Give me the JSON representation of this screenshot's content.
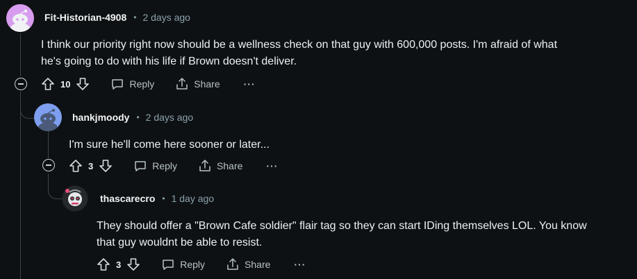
{
  "comments": [
    {
      "author": "Fit-Historian-4908",
      "time": "2 days ago",
      "body_line1": "I think our priority right now should be a wellness check on that guy with 600,000 posts. I'm afraid of what",
      "body_line2": "he's going to do with his life if Brown doesn't deliver.",
      "votes": "10",
      "reply_label": "Reply",
      "share_label": "Share",
      "more_label": "···"
    },
    {
      "author": "hankjmoody",
      "time": "2 days ago",
      "body_line1": "I'm sure he'll come here sooner or later...",
      "votes": "3",
      "reply_label": "Reply",
      "share_label": "Share",
      "more_label": "···"
    },
    {
      "author": "thascarecro",
      "time": "1 day ago",
      "body_line1": "They should offer a \"Brown Cafe soldier\" flair tag so they can start IDing themselves LOL. You know",
      "body_line2": "that guy wouldnt be able to resist.",
      "votes": "3",
      "reply_label": "Reply",
      "share_label": "Share",
      "more_label": "···"
    }
  ],
  "separator": "•",
  "colors": {
    "background": "#0e1113",
    "text": "#eef1f3",
    "muted": "#8ba2ad",
    "thread": "#3e4446"
  },
  "icons": [
    "collapse-icon",
    "upvote-icon",
    "downvote-icon",
    "reply-icon",
    "share-icon",
    "avatar-icon"
  ]
}
